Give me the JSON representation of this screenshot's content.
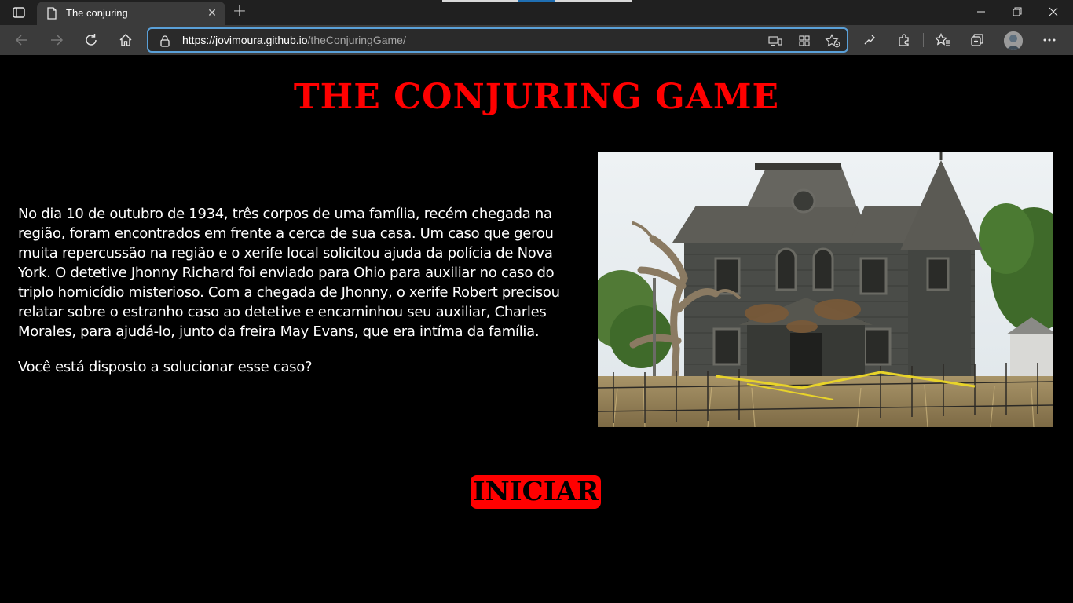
{
  "browser": {
    "tab": {
      "title": "The conjuring",
      "icon": "page-icon"
    },
    "address": {
      "scheme": "https://",
      "host": "jovimoura.github.io",
      "path": "/theConjuringGame/"
    },
    "accent": "#5aa0d8"
  },
  "page": {
    "title": "THE CONJURING GAME",
    "story": "No dia 10 de outubro de 1934, três corpos de uma família, recém chegada na região, foram encontrados em frente a cerca de sua casa. Um caso que gerou muita repercussão na região e o xerife local solicitou ajuda da polícia de Nova York. O detetive Jhonny Richard foi enviado para Ohio para auxiliar no caso do triplo homicídio misterioso. Com a chegada de Jhonny, o xerife Robert precisou relatar sobre o estranho caso ao detetive e encaminhou seu auxiliar, Charles Morales, para ajudá-lo, junto da freira May Evans, que era intíma da família.",
    "question": "Você está disposto a solucionar esse caso?",
    "start_label": "INICIAR",
    "colors": {
      "background": "#000000",
      "title": "#ff0000",
      "text": "#ffffff",
      "button": "#ff0000"
    }
  }
}
